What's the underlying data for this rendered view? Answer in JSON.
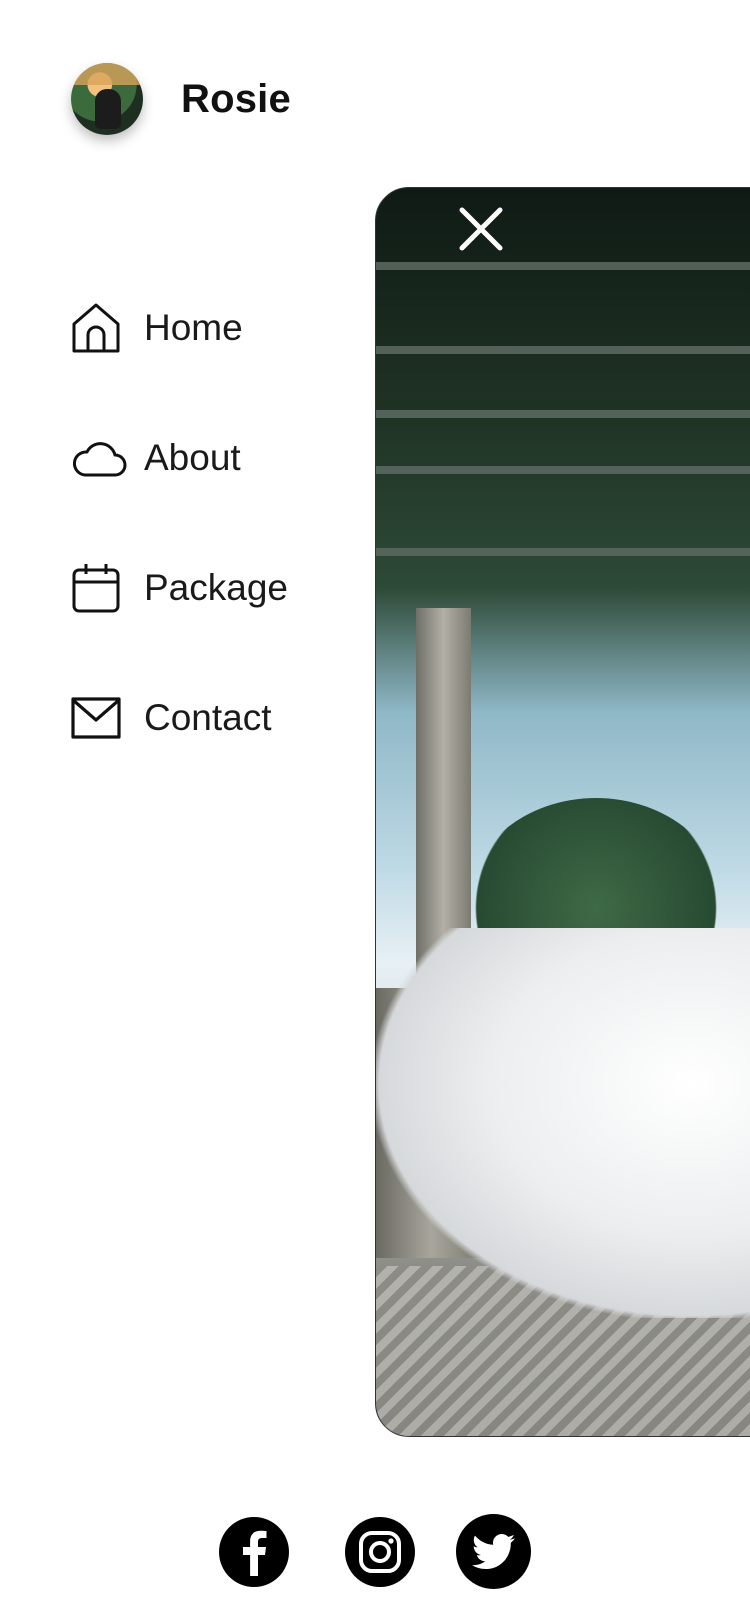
{
  "profile": {
    "name": "Rosie"
  },
  "nav": {
    "items": [
      {
        "label": "Home",
        "icon": "home-icon"
      },
      {
        "label": "About",
        "icon": "cloud-icon"
      },
      {
        "label": "Package",
        "icon": "calendar-icon"
      },
      {
        "label": "Contact",
        "icon": "mail-icon"
      }
    ]
  },
  "photo": {
    "close_icon": "close-icon"
  },
  "social": {
    "items": [
      {
        "icon": "facebook-icon"
      },
      {
        "icon": "instagram-icon"
      },
      {
        "icon": "twitter-icon"
      }
    ]
  },
  "colors": {
    "text": "#111111",
    "background": "#ffffff",
    "social_button": "#000000"
  }
}
